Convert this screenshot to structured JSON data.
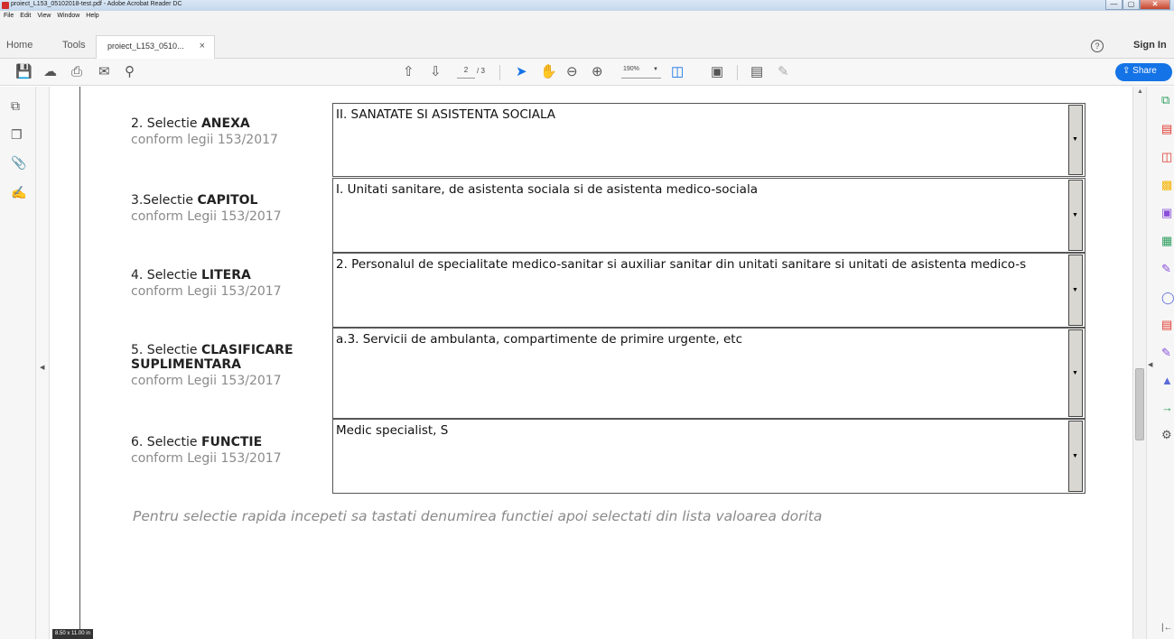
{
  "window": {
    "title": "proiect_L153_05102018-test.pdf - Adobe Acrobat Reader DC",
    "minimize": "—",
    "maximize": "▢",
    "close": "✕"
  },
  "menu": [
    "File",
    "Edit",
    "View",
    "Window",
    "Help"
  ],
  "tabs": {
    "home": "Home",
    "tools": "Tools",
    "document": "proiect_L153_0510...",
    "close": "×"
  },
  "header": {
    "help": "?",
    "sign_in": "Sign In"
  },
  "toolbar": {
    "current_page": "2",
    "total_pages": "/ 3",
    "zoom": "190%",
    "share": "Share"
  },
  "status": {
    "page_size": "8.50 x 11.00 in"
  },
  "form": {
    "fields": [
      {
        "label_prefix": "2. Selectie ",
        "label_bold": "ANEXA",
        "sublabel": "conform legii 153/2017",
        "value": "II. SANATATE SI ASISTENTA SOCIALA"
      },
      {
        "label_prefix": "3.Selectie ",
        "label_bold": "CAPITOL",
        "sublabel": "conform Legii 153/2017",
        "value": "I. Unitati sanitare, de asistenta sociala si de asistenta medico-sociala"
      },
      {
        "label_prefix": "4. Selectie ",
        "label_bold": "LITERA",
        "sublabel": "conform Legii 153/2017",
        "value": "2. Personalul de specialitate medico-sanitar si auxiliar sanitar din unitati sanitare si unitati de asistenta medico-s"
      },
      {
        "label_prefix": "5. Selectie ",
        "label_bold": "CLASIFICARE",
        "label_bold2": "SUPLIMENTARA",
        "sublabel": "conform Legii 153/2017",
        "value": "a.3. Servicii de ambulanta, compartimente de primire urgente, etc"
      },
      {
        "label_prefix": "6.  Selectie ",
        "label_bold": "FUNCTIE",
        "sublabel": "conform Legii 153/2017",
        "value": "Medic specialist, S"
      }
    ],
    "hint": "Pentru selectie rapida incepeti sa tastati denumirea functiei apoi selectati din lista valoarea dorita"
  },
  "icons": {
    "left_rail": [
      "page-thumbnails-icon",
      "copy-pages-icon",
      "attachments-icon",
      "sign-icon"
    ],
    "right_rail": [
      "export-pdf-icon",
      "create-pdf-icon",
      "organize-pages-icon",
      "comment-icon",
      "combine-files-icon",
      "edit-pdf-icon",
      "fill-sign-icon",
      "protect-icon",
      "export-red-icon",
      "send-sign-icon",
      "stamp-icon",
      "send-track-icon",
      "more-tools-icon"
    ]
  },
  "colors": {
    "accent": "#1473e6",
    "hint_gray": "#8a8a8a"
  }
}
